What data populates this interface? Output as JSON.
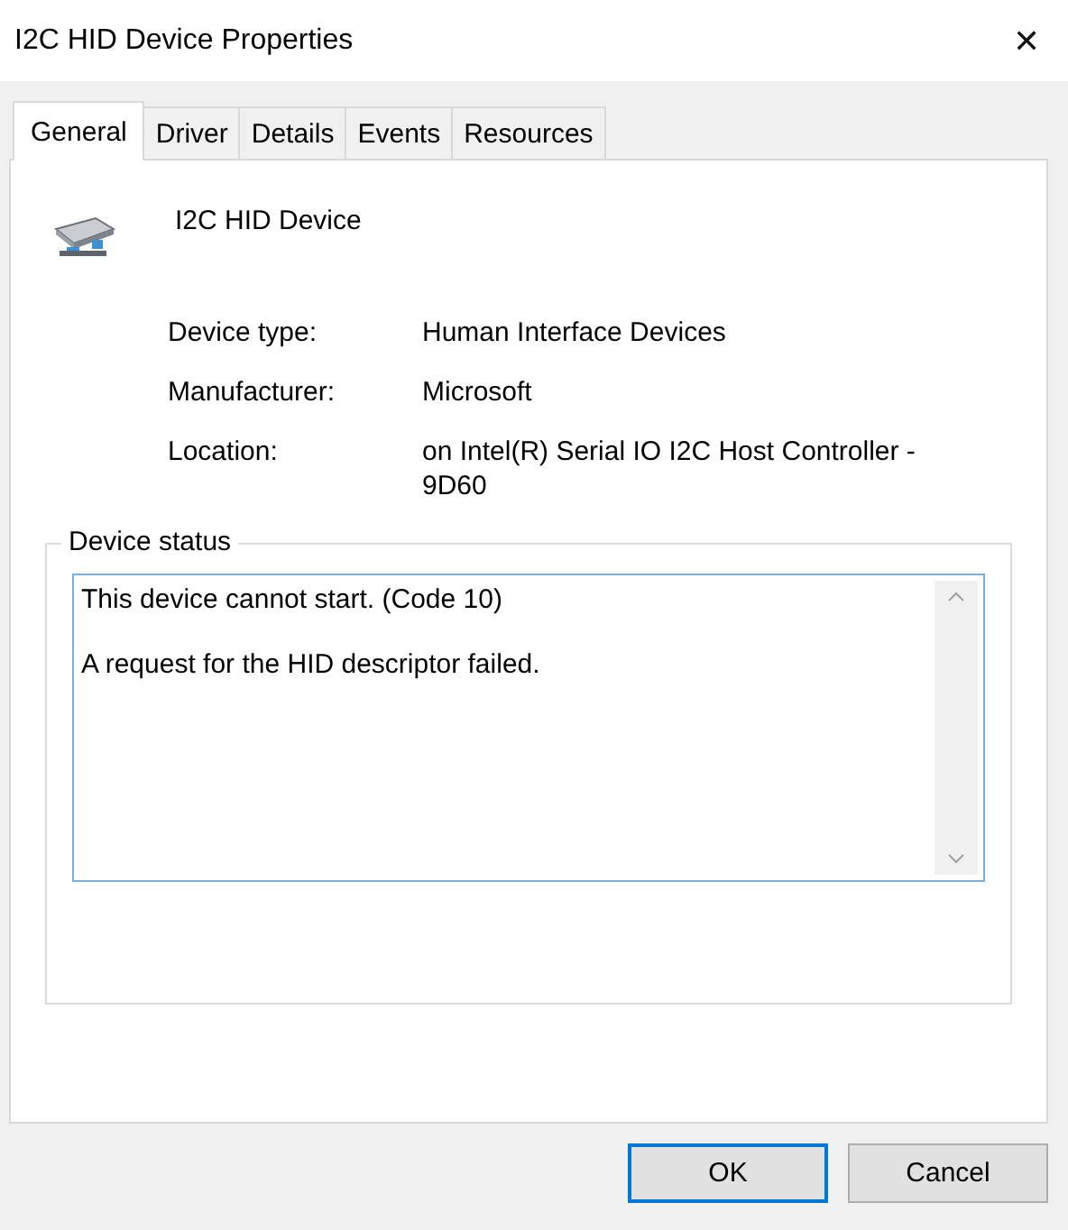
{
  "window": {
    "title": "I2C HID Device Properties",
    "close": "✕"
  },
  "tabs": [
    {
      "label": "General",
      "selected": true
    },
    {
      "label": "Driver",
      "selected": false
    },
    {
      "label": "Details",
      "selected": false
    },
    {
      "label": "Events",
      "selected": false
    },
    {
      "label": "Resources",
      "selected": false
    }
  ],
  "device": {
    "name": "I2C HID Device"
  },
  "properties": [
    {
      "label": "Device type:",
      "value": "Human Interface Devices"
    },
    {
      "label": "Manufacturer:",
      "value": "Microsoft"
    },
    {
      "label": "Location:",
      "value": "on Intel(R) Serial IO I2C Host Controller - 9D60"
    }
  ],
  "device_status": {
    "title": "Device status",
    "lines": [
      "This device cannot start. (Code 10)",
      "A request for the HID descriptor failed."
    ]
  },
  "buttons": [
    {
      "label": "OK",
      "default": true
    },
    {
      "label": "Cancel",
      "default": false
    }
  ]
}
